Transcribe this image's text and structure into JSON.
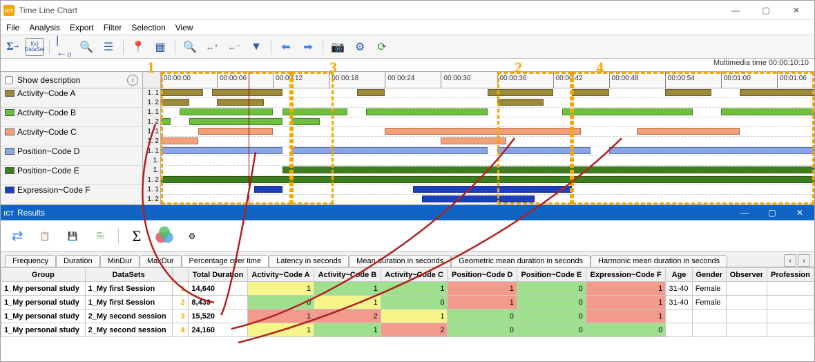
{
  "window": {
    "title": "Time Line Chart"
  },
  "menus": [
    "File",
    "Analysis",
    "Export",
    "Filter",
    "Selection",
    "View"
  ],
  "multimedia_time_label": "Multimedia time 00:00:10:10",
  "show_description_label": "Show description",
  "annotations": {
    "n1": "1",
    "n2": "2",
    "n3": "3",
    "n4": "4"
  },
  "legend": [
    {
      "label": "Activity~Code A",
      "color": "#9b8a3a"
    },
    {
      "label": "Activity~Code B",
      "color": "#6fbf3f"
    },
    {
      "label": "Activity~Code C",
      "color": "#f4a079"
    },
    {
      "label": "Position~Code D",
      "color": "#8aa6e8"
    },
    {
      "label": "Position~Code E",
      "color": "#3f7e1f"
    },
    {
      "label": "Expression~Code F",
      "color": "#1c3fbf"
    }
  ],
  "row_sublabels": [
    "1. 1",
    "1. 2",
    "1. 1",
    "1. 2",
    "1. 1",
    "1. 2",
    "1. 1",
    "1.",
    "1.",
    "1. 2",
    "1. 1",
    "1. 2"
  ],
  "ruler_ticks": [
    "00:00:00",
    "00:00:06",
    "00:00:12",
    "00:00:18",
    "00:00:24",
    "00:00:30",
    "00:00:36",
    "00:00:42",
    "00:00:48",
    "00:00:54",
    "00:01:00",
    "00:01:06"
  ],
  "chart_data": {
    "type": "gantt",
    "x_unit": "seconds",
    "x_range": [
      0,
      70
    ],
    "rows": [
      {
        "track": "Activity~Code A",
        "sub": "1.1",
        "color": "#9b8a3a",
        "bars": [
          [
            0,
            4.5
          ],
          [
            5.5,
            13
          ],
          [
            21,
            24
          ],
          [
            35,
            42
          ],
          [
            44,
            48
          ],
          [
            54,
            59
          ],
          [
            62,
            70
          ]
        ]
      },
      {
        "track": "Activity~Code A",
        "sub": "1.2",
        "color": "#9b8a3a",
        "bars": [
          [
            0,
            3
          ],
          [
            6,
            11
          ],
          [
            36,
            41
          ]
        ]
      },
      {
        "track": "Activity~Code B",
        "sub": "1.1",
        "color": "#6fbf3f",
        "bars": [
          [
            2,
            12
          ],
          [
            13,
            20
          ],
          [
            22,
            35
          ],
          [
            43,
            57
          ],
          [
            60,
            70
          ]
        ]
      },
      {
        "track": "Activity~Code B",
        "sub": "1.2",
        "color": "#6fbf3f",
        "bars": [
          [
            0,
            1
          ],
          [
            3,
            13
          ],
          [
            14,
            17
          ]
        ]
      },
      {
        "track": "Activity~Code C",
        "sub": "1.1",
        "color": "#f4a079",
        "bars": [
          [
            4,
            12
          ],
          [
            24,
            45
          ],
          [
            51,
            62
          ]
        ]
      },
      {
        "track": "Activity~Code C",
        "sub": "1.2",
        "color": "#f4a079",
        "bars": [
          [
            0,
            4
          ],
          [
            30,
            37
          ]
        ]
      },
      {
        "track": "Position~Code D",
        "sub": "1.1",
        "color": "#8aa6e8",
        "bars": [
          [
            0,
            13
          ],
          [
            14,
            35
          ],
          [
            36,
            46
          ],
          [
            48,
            70
          ]
        ]
      },
      {
        "track": "Position~Code D",
        "sub": "1.",
        "color": "#8aa6e8",
        "bars": []
      },
      {
        "track": "Position~Code E",
        "sub": "1.",
        "color": "#3f7e1f",
        "bars": [
          [
            13,
            70
          ]
        ]
      },
      {
        "track": "Position~Code E",
        "sub": "1.2",
        "color": "#3f7e1f",
        "bars": [
          [
            0,
            70
          ]
        ]
      },
      {
        "track": "Expression~Code F",
        "sub": "1.1",
        "color": "#1c3fbf",
        "bars": [
          [
            10,
            13
          ],
          [
            27,
            44
          ]
        ]
      },
      {
        "track": "Expression~Code F",
        "sub": "1.2",
        "color": "#1c3fbf",
        "bars": [
          [
            28,
            40
          ]
        ]
      }
    ],
    "playhead_sec": 9.4
  },
  "results": {
    "title": "Results",
    "tabs": [
      "Frequency",
      "Duration",
      "MinDur",
      "MaxDur",
      "Percentage over time",
      "Latency in seconds",
      "Mean duration in seconds",
      "Geometric mean duration in seconds",
      "Harmonic mean duration in seconds"
    ],
    "active_tab": "Percentage over time",
    "columns": [
      "Group",
      "DataSets",
      "",
      "Total Duration",
      "Activity~Code A",
      "Activity~Code B",
      "Activity~Code C",
      "Position~Code D",
      "Position~Code E",
      "Expression~Code F",
      "Age",
      "Gender",
      "Observer",
      "Profession"
    ],
    "rows": [
      {
        "num": "1",
        "group": "1_My personal study",
        "dataset": "1_My first Session",
        "dur": "14,640",
        "vals": [
          {
            "v": "1",
            "c": "yellow"
          },
          {
            "v": "1",
            "c": "green"
          },
          {
            "v": "1",
            "c": "green"
          },
          {
            "v": "1",
            "c": "red"
          },
          {
            "v": "0",
            "c": "green"
          },
          {
            "v": "1",
            "c": "red"
          }
        ],
        "age": "31-40",
        "gender": "Female"
      },
      {
        "num": "2",
        "group": "1_My personal study",
        "dataset": "1_My first Session",
        "dur": "8,439",
        "vals": [
          {
            "v": "0",
            "c": "green"
          },
          {
            "v": "1",
            "c": "yellow"
          },
          {
            "v": "0",
            "c": "green"
          },
          {
            "v": "1",
            "c": "red"
          },
          {
            "v": "0",
            "c": "green"
          },
          {
            "v": "1",
            "c": "red"
          }
        ],
        "age": "31-40",
        "gender": "Female"
      },
      {
        "num": "3",
        "group": "1_My personal study",
        "dataset": "2_My second session",
        "dur": "15,520",
        "vals": [
          {
            "v": "1",
            "c": "red"
          },
          {
            "v": "2",
            "c": "red"
          },
          {
            "v": "1",
            "c": "yellow"
          },
          {
            "v": "0",
            "c": "green"
          },
          {
            "v": "0",
            "c": "green"
          },
          {
            "v": "1",
            "c": "red"
          }
        ],
        "age": "",
        "gender": ""
      },
      {
        "num": "4",
        "group": "1_My personal study",
        "dataset": "2_My second session",
        "dur": "24,160",
        "vals": [
          {
            "v": "1",
            "c": "yellow"
          },
          {
            "v": "1",
            "c": "green"
          },
          {
            "v": "2",
            "c": "red"
          },
          {
            "v": "0",
            "c": "green"
          },
          {
            "v": "0",
            "c": "green"
          },
          {
            "v": "0",
            "c": "green"
          }
        ],
        "age": "",
        "gender": ""
      }
    ]
  }
}
